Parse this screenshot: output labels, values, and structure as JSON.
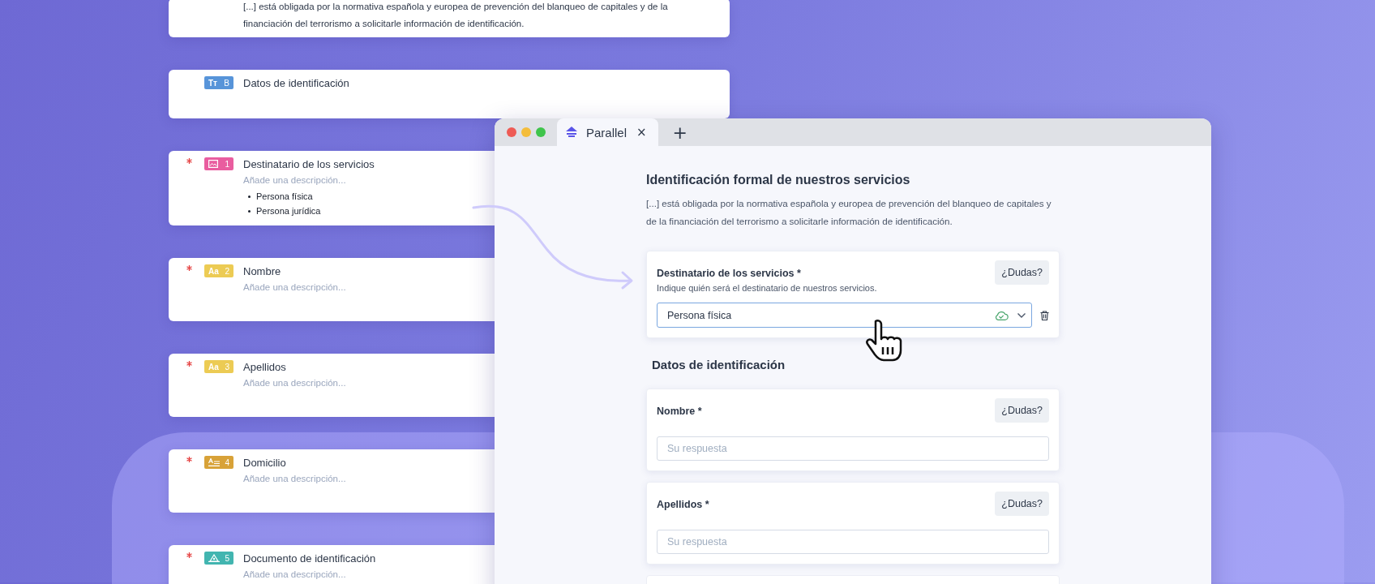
{
  "left_cards": [
    {
      "kind": "text",
      "text": "[...] está obligada por la normativa española y europea de prevención del blanqueo de capitales y de la financiación del terrorismo a solicitarle información de identificación."
    },
    {
      "kind": "heading",
      "required": false,
      "color": "#4f8fd8",
      "icon_text": "Tт",
      "number": "B",
      "title": "Datos de identificación"
    },
    {
      "kind": "select",
      "required": true,
      "color": "#e8559a",
      "number": "1",
      "title": "Destinatario de los servicios",
      "placeholder": "Añade una descripción...",
      "options": [
        "Persona física",
        "Persona jurídica"
      ]
    },
    {
      "kind": "short_text",
      "required": true,
      "color": "#ecc94b",
      "icon_text": "Aa",
      "number": "2",
      "title": "Nombre",
      "placeholder": "Añade una descripción..."
    },
    {
      "kind": "short_text",
      "required": true,
      "color": "#ecc94b",
      "icon_text": "Aa",
      "number": "3",
      "title": "Apellidos",
      "placeholder": "Añade una descripción..."
    },
    {
      "kind": "address",
      "required": true,
      "color": "#d69e2e",
      "number": "4",
      "title": "Domicilio",
      "placeholder": "Añade una descripción..."
    },
    {
      "kind": "document",
      "required": true,
      "color": "#38b2ac",
      "number": "5",
      "title": "Documento de identificación",
      "placeholder": "Añade una descripción..."
    }
  ],
  "browser": {
    "tabs": [
      {
        "title": "Parallel",
        "selected": true,
        "close_glyph": "×"
      }
    ],
    "new_tab_glyph": "+",
    "form": {
      "title": "Identificación formal de nuestros servicios",
      "description": "[...] está obligada por la normativa española y europea de prevención del blanqueo de capitales y de la financiación del terrorismo a solicitarle información de identificación.",
      "blocks": [
        {
          "kind": "select",
          "label": "Destinatario de los servicios *",
          "hint": "Indique quién será el destinatario de nuestros servicios.",
          "help_button": "¿Dudas?",
          "value": "Persona física",
          "focused": true
        },
        {
          "kind": "heading",
          "title": "Datos de identificación"
        },
        {
          "kind": "text",
          "label": "Nombre *",
          "help_button": "¿Dudas?",
          "placeholder": "Su respuesta",
          "focused": false
        },
        {
          "kind": "text",
          "label": "Apellidos *",
          "help_button": "¿Dudas?",
          "placeholder": "Su respuesta",
          "focused": false
        }
      ]
    }
  }
}
